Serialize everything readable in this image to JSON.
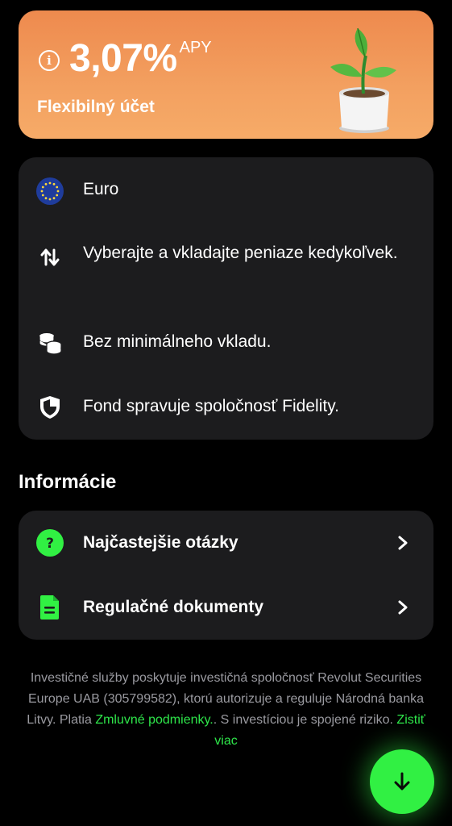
{
  "rate_card": {
    "rate": "3,07%",
    "unit": "APY",
    "account_name": "Flexibilný účet",
    "background_color": "#f09a5a"
  },
  "features": [
    {
      "icon": "euro-flag-icon",
      "text": "Euro"
    },
    {
      "icon": "transfer-arrows-icon",
      "text": "Vyberajte a vkladajte peniaze kedykoľvek."
    },
    {
      "icon": "coins-icon",
      "text": "Bez minimálneho vkladu."
    },
    {
      "icon": "shield-icon",
      "text": "Fond spravuje spoločnosť Fidelity."
    }
  ],
  "info_section": {
    "title": "Informácie",
    "links": [
      {
        "icon": "question-icon",
        "label": "Najčastejšie otázky"
      },
      {
        "icon": "document-icon",
        "label": "Regulačné dokumenty"
      }
    ]
  },
  "disclaimer": {
    "text_1": "Investičné služby poskytuje investičná spoločnosť Revolut Securities Europe UAB (305799582), ktorú autorizuje a reguluje Národná banka Litvy. Platia ",
    "link_terms": "Zmluvné podmienky.",
    "text_2": ". S investíciou je spojené riziko. ",
    "link_more": "Zistiť viac"
  },
  "fab": {
    "icon": "arrow-down-icon"
  },
  "colors": {
    "accent_green": "#31f043",
    "card_bg": "#1c1c1e",
    "page_bg": "#000000"
  }
}
